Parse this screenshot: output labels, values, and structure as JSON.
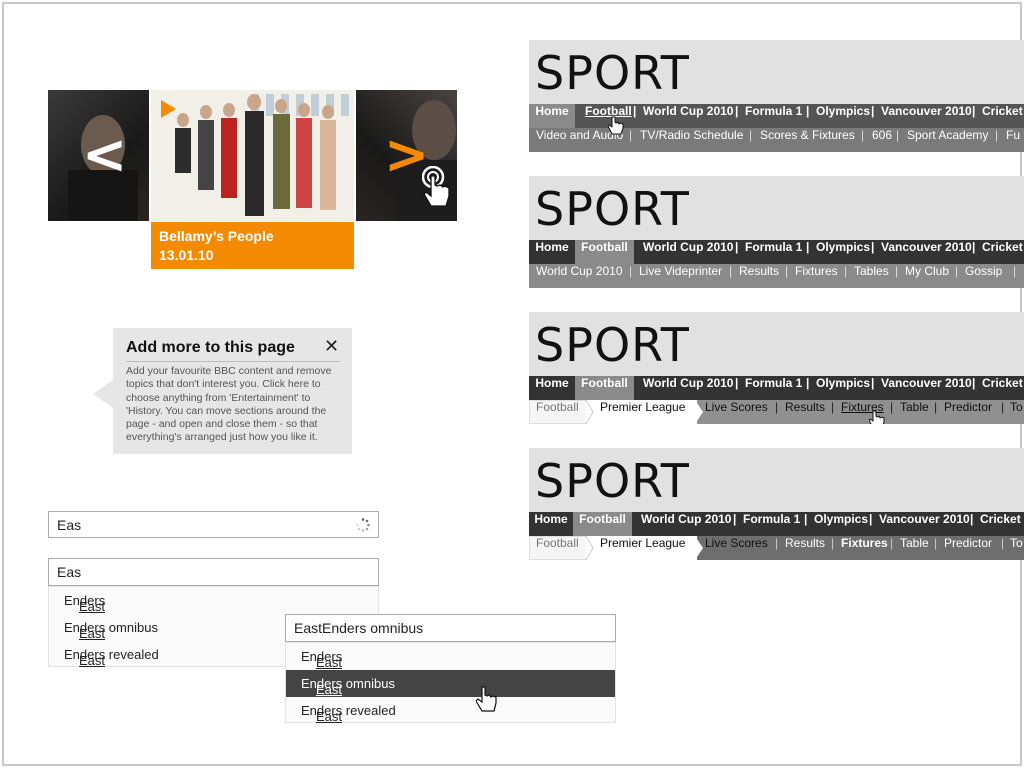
{
  "carousel": {
    "prev_glyph": "<",
    "next_glyph": ">",
    "caption_title": "Bellamy’s People",
    "caption_date": "13.01.10",
    "accent": "#f38a00"
  },
  "tooltip": {
    "title": "Add more to this page",
    "close_glyph": "✕",
    "body": "Add your favourite BBC content and remove topics that don't interest you. Click here to choose anything from 'Entertainment' to 'History. You can move sections around the page - and open and close them - so that everything's arranged just how you like it."
  },
  "search": {
    "box1_value": "Eas",
    "box2_value": "Eas",
    "suggestions": [
      {
        "match": "East",
        "rest": "Enders"
      },
      {
        "match": "East",
        "rest": "Enders omnibus"
      },
      {
        "match": "East",
        "rest": "Enders revealed"
      }
    ],
    "box3_value": "EastEnders omnibus",
    "suggestions3": [
      {
        "match": "East",
        "rest": "Enders"
      },
      {
        "match": "East",
        "rest": "Enders omnibus"
      },
      {
        "match": "East",
        "rest": "Enders revealed"
      }
    ]
  },
  "sport": {
    "logo": "SPORT",
    "nav": [
      "Home",
      "Football",
      "World Cup 2010",
      "Formula 1",
      "Olympics",
      "Vancouver 2010",
      "Cricket"
    ],
    "sep": "|",
    "v1_sub": [
      "Video and Audio",
      "TV/Radio Schedule",
      "Scores & Fixtures",
      "606",
      "Sport Academy",
      "Fu"
    ],
    "v2_sub": [
      "World Cup 2010",
      "Live Videprinter",
      "Results",
      "Fixtures",
      "Tables",
      "My Club",
      "Gossip"
    ],
    "crumb1": "Football",
    "crumb2": "Premier League",
    "v3_sub": [
      "Live Scores",
      "Results",
      "Fixtures",
      "Table",
      "Predictor",
      "To"
    ]
  }
}
